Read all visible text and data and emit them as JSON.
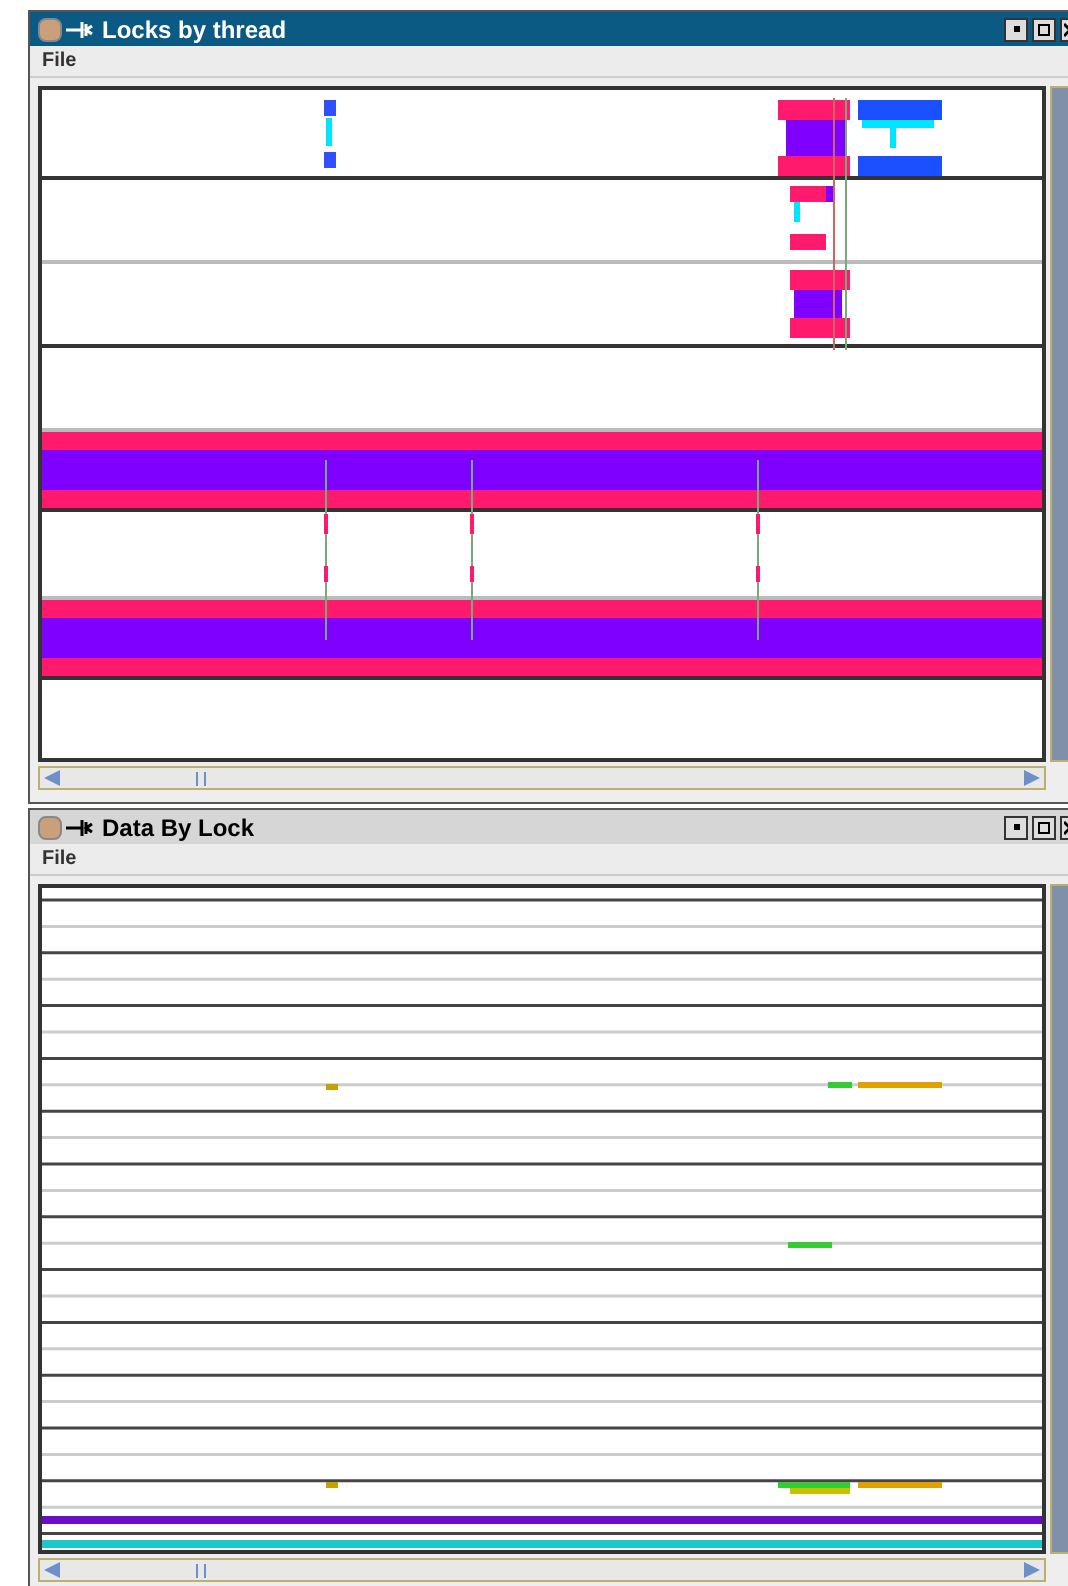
{
  "windows": [
    {
      "title": "Locks by thread",
      "active": true,
      "menu": [
        "File"
      ],
      "kind": "thread-lanes"
    },
    {
      "title": "Data By Lock",
      "active": false,
      "menu": [
        "File"
      ],
      "kind": "lock-lanes"
    }
  ]
}
